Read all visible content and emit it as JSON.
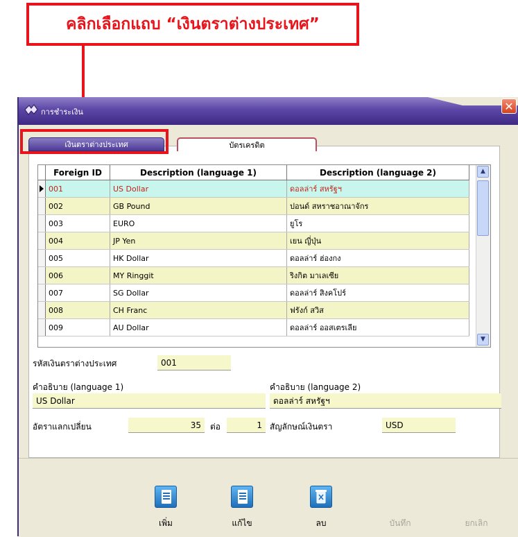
{
  "annotation": {
    "text": "คลิกเลือกแถบ “เงินตราต่างประเทศ”"
  },
  "window": {
    "title": "การชำระเงิน",
    "close": "✕"
  },
  "tabs": [
    {
      "label": "เงินตราต่างประเทศ",
      "active": true
    },
    {
      "label": "บัตรเครดิต",
      "active": false
    }
  ],
  "grid": {
    "headers": [
      "Foreign ID",
      "Description (language 1)",
      "Description (language 2)"
    ],
    "rows": [
      {
        "id": "001",
        "d1": "US Dollar",
        "d2": "ดอลล่าร์ สหรัฐฯ"
      },
      {
        "id": "002",
        "d1": "GB Pound",
        "d2": "ปอนด์ สหราชอาณาจักร"
      },
      {
        "id": "003",
        "d1": "EURO",
        "d2": "ยูโร"
      },
      {
        "id": "004",
        "d1": "JP Yen",
        "d2": "เยน ญี่ปุ่น"
      },
      {
        "id": "005",
        "d1": "HK Dollar",
        "d2": "ดอลล่าร์ ฮ่องกง"
      },
      {
        "id": "006",
        "d1": "MY Ringgit",
        "d2": "ริงกิต มาเลเซีย"
      },
      {
        "id": "007",
        "d1": "SG Dollar",
        "d2": "ดอลล่าร์ สิงคโปร์"
      },
      {
        "id": "008",
        "d1": "CH Franc",
        "d2": "ฟรังก์ สวิส"
      },
      {
        "id": "009",
        "d1": "AU Dollar",
        "d2": "ดอลล่าร์ ออสเตรเลีย"
      }
    ],
    "selected_index": 0
  },
  "form": {
    "currency_code_label": "รหัสเงินตราต่างประเทศ",
    "currency_code_value": "001",
    "desc1_label": "คำอธิบาย (language 1)",
    "desc1_value": "US Dollar",
    "desc2_label": "คำอธิบาย (language 2)",
    "desc2_value": "ดอลล่าร์ สหรัฐฯ",
    "rate_label": "อัตราแลกเปลี่ยน",
    "rate_value": "35",
    "per_label": "ต่อ",
    "per_value": "1",
    "symbol_label": "สัญลักษณ์เงินตรา",
    "symbol_value": "USD"
  },
  "toolbar": {
    "add_label": "เพิ่ม",
    "edit_label": "แก้ไข",
    "delete_label": "ลบ",
    "save_label": "บันทึก",
    "cancel_label": "ยกเลิก"
  },
  "colors": {
    "accent_red": "#e8141b",
    "title_purple": "#4d3a96",
    "row_alt": "#f3f5c6",
    "row_selected": "#c9f6ec"
  }
}
